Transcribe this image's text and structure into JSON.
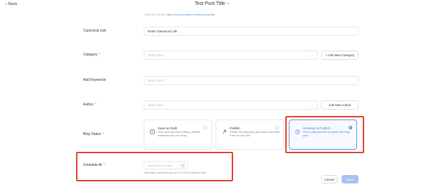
{
  "header": {
    "back_label": "Back",
    "title": "Test Post Title",
    "url_prefix": "Your URL will be:",
    "url_value": "https://blog.example.com/test-post-title"
  },
  "form": {
    "canonical_link": {
      "label": "Canonical Link",
      "value": "Enter Canonical Link"
    },
    "category": {
      "label": "Category",
      "required": "*",
      "placeholder": "Select one",
      "add_button": "+ Add New Category"
    },
    "keywords": {
      "label": "Add Keywords",
      "placeholder": "Select one"
    },
    "author": {
      "label": "Author",
      "required": "*",
      "placeholder": "Select one",
      "add_button": "Add New Author"
    },
    "blog_status": {
      "label": "Blog Status",
      "required": "*",
      "options": [
        {
          "title": "Save as Draft",
          "desc": "Save now and keep editing, publish whenever you are ready",
          "selected": false,
          "icon": "draft-icon"
        },
        {
          "title": "Publish",
          "desc": "Publish the blog post right away and make it live on your site",
          "selected": false,
          "icon": "publish-icon"
        },
        {
          "title": "Schedule & Publish",
          "desc": "Pick a date and time to publish the blog post",
          "selected": true,
          "icon": "schedule-icon"
        }
      ]
    },
    "schedule_at": {
      "label": "Schedule At",
      "required": "*",
      "placeholder": "Select date and time",
      "hint": "Valid date and timezone (UTC+00:00) shown here"
    }
  },
  "actions": {
    "cancel": "Cancel",
    "save": "Save"
  },
  "colors": {
    "accent": "#4c7ad3",
    "highlight": "#e3402f",
    "save_disabled": "#a9c0f0"
  }
}
